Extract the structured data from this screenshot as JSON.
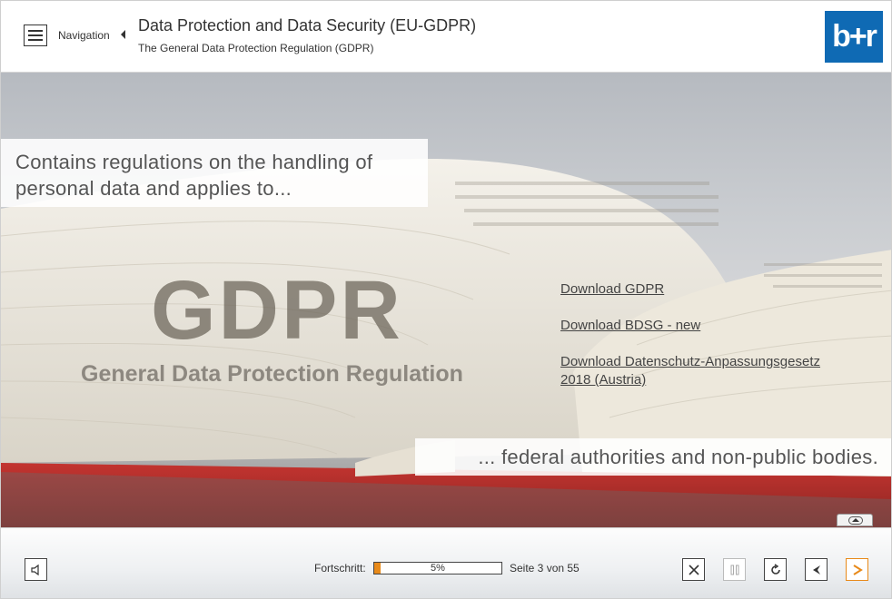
{
  "header": {
    "nav_label": "Navigation",
    "title": "Data Protection and Data Security (EU-GDPR)",
    "subtitle": "The General Data Protection Regulation (GDPR)",
    "logo_text": "b+r"
  },
  "stage": {
    "callout_top": "Contains regulations on the handling of personal data and applies to...",
    "callout_bottom": "... federal authorities and non-public bodies.",
    "gdpr_big": "GDPR",
    "gdpr_sub": "General Data Protection Regulation",
    "links": [
      {
        "label": "Download GDPR"
      },
      {
        "label": "Download BDSG - new"
      },
      {
        "label": "Download Datenschutz-Anpassungsgesetz 2018 (Austria)"
      }
    ]
  },
  "footer": {
    "progress_label": "Fortschritt:",
    "progress_percent_text": "5%",
    "progress_value": 5,
    "page_label": "Seite 3 von 55"
  },
  "colors": {
    "accent": "#e88a1a",
    "logo_bg": "#0f6ab4"
  },
  "icons": [
    "menu-icon",
    "chevron-left-icon",
    "speaker-icon",
    "close-icon",
    "pause-icon",
    "reload-icon",
    "back-arrow-icon",
    "next-arrow-icon",
    "collapse-up-icon"
  ]
}
